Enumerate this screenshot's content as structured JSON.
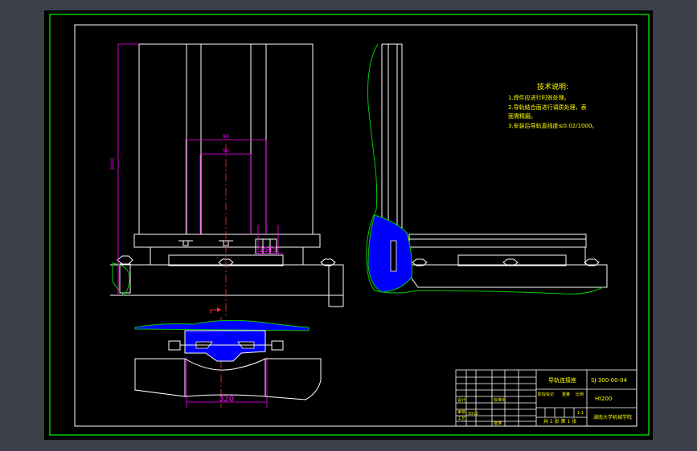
{
  "drawing": {
    "tech_notes": {
      "heading": "技术说明:",
      "lines": [
        "1.焊件应进行时效处理。",
        "2.导轨结合面进行调质处理，表",
        "面需精磨。",
        "3.安装后导轨直线度≤0.02/1000。"
      ]
    },
    "dimensions": {
      "height": "3000",
      "width_outer": "90",
      "width_inner": "50",
      "small_a": "15",
      "small_b": "45",
      "bottom_width": "320"
    }
  },
  "title_block": {
    "part_name": "导轨连接座",
    "drawing_number": "SJ-300-00-04",
    "material": "Ht200",
    "designer_label": "设计",
    "date_value": "2012",
    "std_label": "标准化",
    "process_label": "工艺",
    "approve_label": "批准",
    "review_label": "审核",
    "stage_label": "阶段标记",
    "weight_label": "重量",
    "scale_label": "比例",
    "ratio_value": "1:1",
    "sheets_text": "共 1 张   第 1 张",
    "school": "湖南大学机械学院"
  },
  "colors": {
    "background": "#000000",
    "border": "#00ff00",
    "lines": "#ffffff",
    "dimension": "#ff00ff",
    "centerline": "#ff0000",
    "hatch": "#0000ff",
    "outline": "#00cc00",
    "text": "#ffff00"
  }
}
